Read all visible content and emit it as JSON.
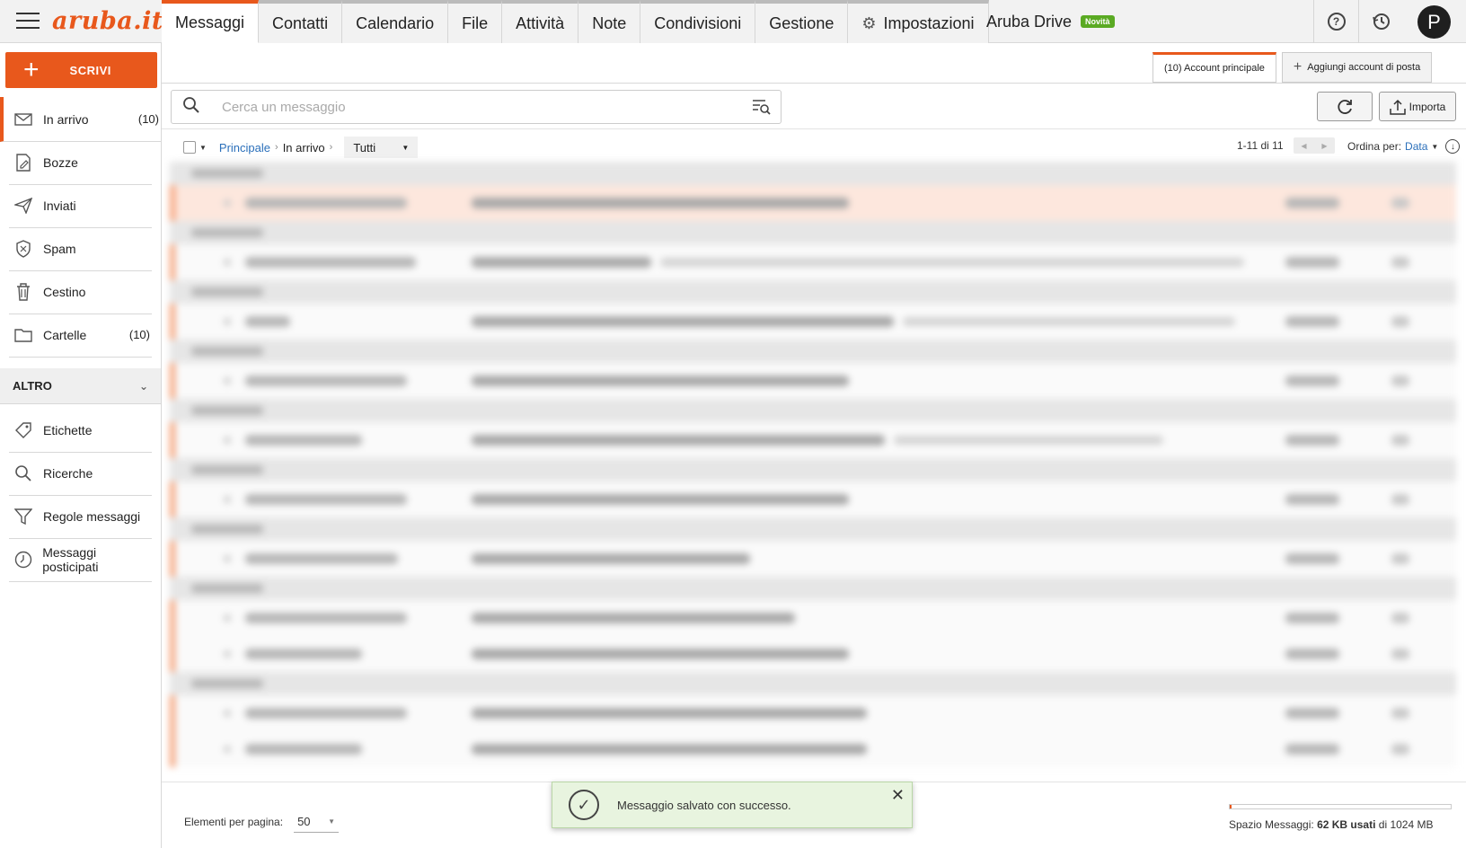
{
  "brand": {
    "logo": "aruba.it",
    "accent": "#e8581c"
  },
  "tabs": [
    {
      "label": "Messaggi"
    },
    {
      "label": "Contatti"
    },
    {
      "label": "Calendario"
    },
    {
      "label": "File"
    },
    {
      "label": "Attività"
    },
    {
      "label": "Note"
    },
    {
      "label": "Condivisioni"
    },
    {
      "label": "Gestione"
    },
    {
      "label": "Impostazioni"
    }
  ],
  "drive": {
    "label": "Aruba Drive",
    "badge": "Novità"
  },
  "topbar_icons": {
    "help": "?",
    "history": "history-icon",
    "avatar": "P"
  },
  "sidebar": {
    "compose": "SCRIVI",
    "items": [
      {
        "label": "In arrivo",
        "count": "(10)"
      },
      {
        "label": "Bozze",
        "count": ""
      },
      {
        "label": "Inviati",
        "count": ""
      },
      {
        "label": "Spam",
        "count": ""
      },
      {
        "label": "Cestino",
        "count": ""
      },
      {
        "label": "Cartelle",
        "count": "(10)"
      }
    ],
    "section": "ALTRO",
    "extra": [
      {
        "label": "Etichette"
      },
      {
        "label": "Ricerche"
      },
      {
        "label": "Regole messaggi"
      },
      {
        "label": "Messaggi posticipati"
      }
    ]
  },
  "accounts": {
    "main": "(10) Account principale",
    "add": "Aggiungi account di posta"
  },
  "search": {
    "placeholder": "Cerca un messaggio"
  },
  "buttons": {
    "import": "Importa"
  },
  "breadcrumb": {
    "root": "Principale",
    "current": "In arrivo",
    "filter": "Tutti"
  },
  "pager": {
    "range": "1-11 di 11",
    "sort_label": "Ordina per:",
    "sort_value": "Data"
  },
  "footer": {
    "perpage_label": "Elementi per pagina:",
    "perpage_value": "50",
    "quota_label": "Spazio Messaggi:",
    "quota_used": "62 KB usati",
    "quota_of": "di 1024 MB",
    "quota_fraction": 0.01
  },
  "toast": {
    "message": "Messaggio salvato con successo."
  }
}
